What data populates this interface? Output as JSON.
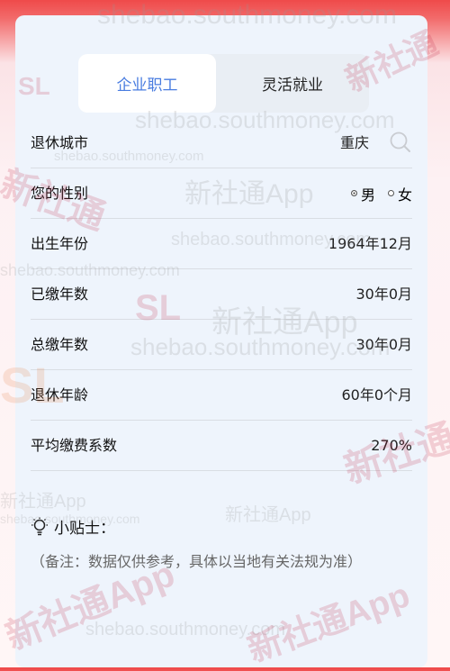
{
  "tabs": [
    {
      "label": "企业职工",
      "active": true
    },
    {
      "label": "灵活就业",
      "active": false
    }
  ],
  "form": {
    "city": {
      "label": "退休城市",
      "value": "重庆"
    },
    "gender": {
      "label": "您的性别",
      "options": [
        "男",
        "女"
      ],
      "selected": "男"
    },
    "birth": {
      "label": "出生年份",
      "value": "1964年12月"
    },
    "paid_years": {
      "label": "已缴年数",
      "value": "30年0月"
    },
    "total_years": {
      "label": "总缴年数",
      "value": "30年0月"
    },
    "retire_age": {
      "label": "退休年龄",
      "value": "60年0个月"
    },
    "coefficient": {
      "label": "平均缴费系数",
      "value": "270%"
    }
  },
  "tip": {
    "title": "小贴士：",
    "note": "（备注：数据仅供参考，具体以当地有关法规为准）"
  },
  "watermark": {
    "site": "shebao.southmoney.com",
    "app": "新社通App",
    "brand": "新社通",
    "logo": "SL"
  },
  "colors": {
    "accent": "#4a7de0",
    "header_red": "#ef4a4a"
  }
}
